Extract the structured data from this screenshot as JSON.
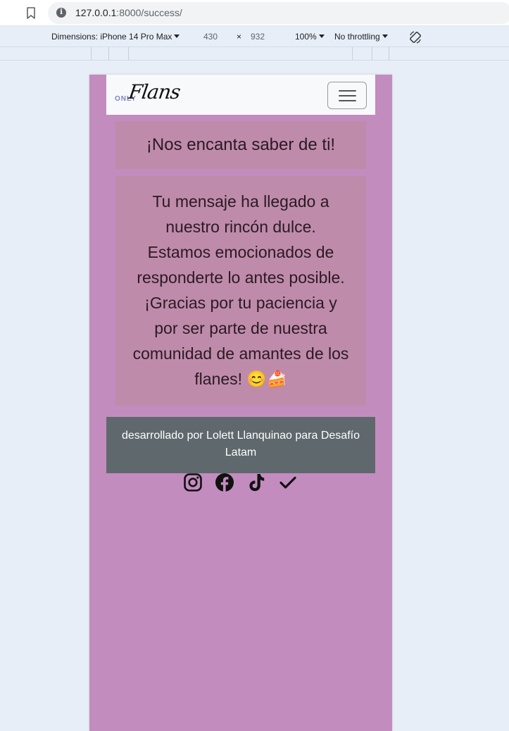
{
  "browser": {
    "url_host": "127.0.0.1",
    "url_rest": ":8000/success/"
  },
  "device_toolbar": {
    "dimensions_label": "Dimensions: iPhone 14 Pro Max",
    "width": "430",
    "times": "×",
    "height": "932",
    "zoom": "100%",
    "throttling": "No throttling"
  },
  "navbar": {
    "brand_small": "ONLY",
    "brand_script": "Flans"
  },
  "main": {
    "title": "¡Nos encanta saber de ti!",
    "message": "Tu mensaje ha llegado a nuestro rincón dulce. Estamos emocionados de responderte lo antes posible. ¡Gracias por tu paciencia y por ser parte de nuestra comunidad de amantes de los flanes! 😊🍰"
  },
  "footer": {
    "credit": "desarrollado por Lolett Llanquinao para Desafío Latam",
    "social_icons": [
      "instagram-icon",
      "facebook-icon",
      "tiktok-icon",
      "check-icon"
    ]
  },
  "colors": {
    "page_bg": "#c38cbf",
    "card_bg": "#bf8bab",
    "footer_bg": "#5f686c",
    "navbar_bg": "#f8f9fa"
  }
}
